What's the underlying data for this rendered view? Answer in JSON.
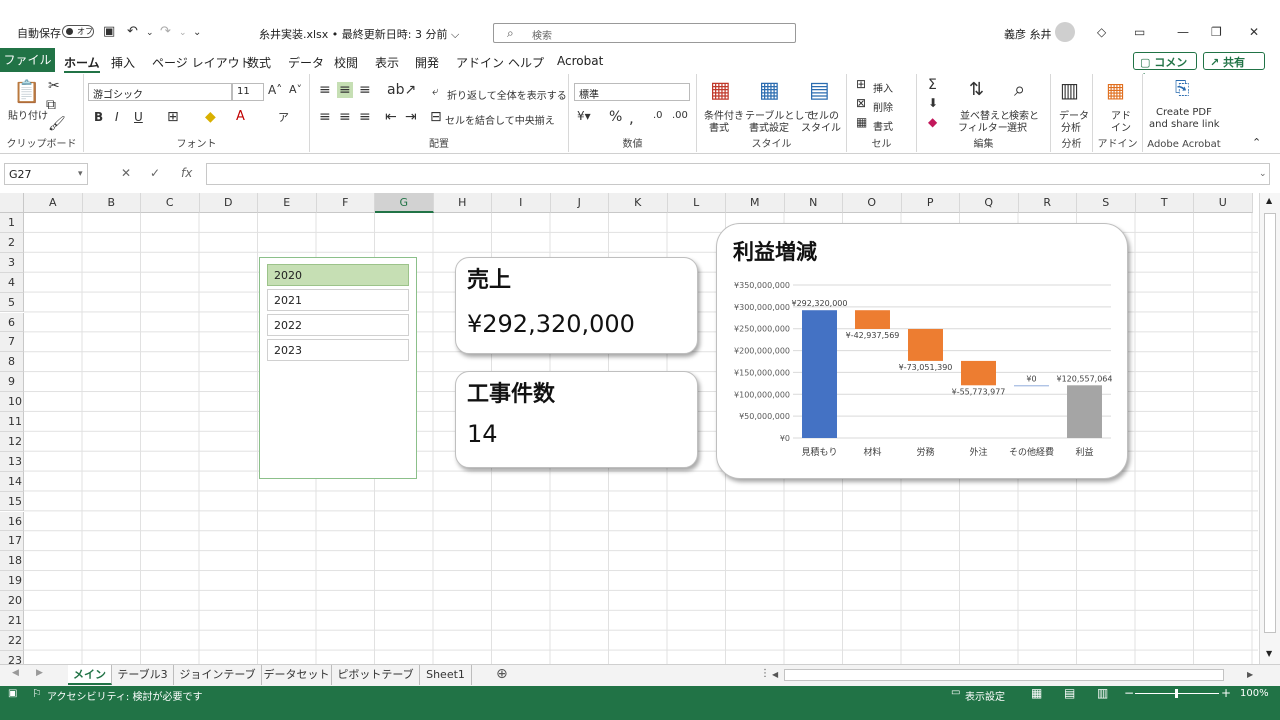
{
  "titlebar": {
    "autosave_label": "自動保存",
    "autosave_state": "オフ",
    "filename": "糸井実装.xlsx • 最終更新日時: 3 分前 ⌵",
    "search_placeholder": "検索",
    "user_name": "義彦 糸井"
  },
  "tabs": {
    "file": "ファイル",
    "home": "ホーム",
    "insert": "挿入",
    "page_layout": "ページ レイアウト",
    "formulas": "数式",
    "data": "データ",
    "review": "校閲",
    "view": "表示",
    "developer": "開発",
    "addins": "アドイン",
    "help": "ヘルプ",
    "acrobat": "Acrobat",
    "comment_btn": "コメント",
    "share_btn": "共有"
  },
  "ribbon": {
    "clipboard": {
      "label": "クリップボード",
      "paste": "貼り付け"
    },
    "font": {
      "label": "フォント",
      "font_name": "游ゴシック",
      "font_size": "11"
    },
    "alignment": {
      "label": "配置",
      "wrap": "折り返して全体を表示する",
      "merge": "セルを結合して中央揃え"
    },
    "number": {
      "label": "数値",
      "format": "標準"
    },
    "styles": {
      "label": "スタイル",
      "cond_line1": "条件付き",
      "cond_line2": "書式",
      "table_line1": "テーブルとして",
      "table_line2": "書式設定",
      "cell_line1": "セルの",
      "cell_line2": "スタイル"
    },
    "cells": {
      "label": "セル",
      "insert": "挿入",
      "delete": "削除",
      "format": "書式"
    },
    "editing": {
      "label": "編集",
      "sort_line1": "並べ替えと",
      "sort_line2": "フィルター",
      "find_line1": "検索と",
      "find_line2": "選択"
    },
    "analysis": {
      "label": "分析",
      "btn_line1": "データ",
      "btn_line2": "分析"
    },
    "addins": {
      "label": "アドイン",
      "btn_line1": "アド",
      "btn_line2": "イン"
    },
    "acrobat": {
      "label": "Adobe Acrobat",
      "btn_line1": "Create PDF",
      "btn_line2": "and share link"
    }
  },
  "formula_bar": {
    "name_box": "G27",
    "fx": "fx",
    "value": ""
  },
  "columns": [
    "A",
    "B",
    "C",
    "D",
    "E",
    "F",
    "G",
    "H",
    "I",
    "J",
    "K",
    "L",
    "M",
    "N",
    "O",
    "P",
    "Q",
    "R",
    "S",
    "T",
    "U"
  ],
  "selected_column": "G",
  "rows": [
    "1",
    "2",
    "3",
    "4",
    "5",
    "6",
    "7",
    "8",
    "9",
    "10",
    "11",
    "12",
    "13",
    "14",
    "15",
    "16",
    "17",
    "18",
    "19",
    "20",
    "21",
    "22",
    "23"
  ],
  "slicer": {
    "items": [
      "2020",
      "2021",
      "2022",
      "2023"
    ],
    "selected": "2020"
  },
  "cards": {
    "sales": {
      "title": "売上",
      "value": "¥292,320,000"
    },
    "jobs": {
      "title": "工事件数",
      "value": "14"
    }
  },
  "chart_data": {
    "type": "bar",
    "subtype": "waterfall",
    "title": "利益増減",
    "categories": [
      "見積もり",
      "材料",
      "労務",
      "外注",
      "その他経費",
      "利益"
    ],
    "values": [
      292320000,
      -42937569,
      -73051390,
      -55773977,
      0,
      120557064
    ],
    "data_labels": [
      "¥292,320,000",
      "¥-42,937,569",
      "¥-73,051,390",
      "¥-55,773,977",
      "¥0",
      "¥120,557,064"
    ],
    "ylim": [
      0,
      350000000
    ],
    "yticks": [
      0,
      50000000,
      100000000,
      150000000,
      200000000,
      250000000,
      300000000,
      350000000
    ],
    "ytick_labels": [
      "¥0",
      "¥50,000,000",
      "¥100,000,000",
      "¥150,000,000",
      "¥200,000,000",
      "¥250,000,000",
      "¥300,000,000",
      "¥350,000,000"
    ],
    "grid": true,
    "legend": "none",
    "colors": {
      "total_start": "#4472C4",
      "decrease": "#ED7D31",
      "total_end": "#A5A5A5"
    }
  },
  "sheet_tabs": [
    "メイン",
    "テーブル3",
    "ジョインテーブル",
    "データセット",
    "ピボットテーブル",
    "Sheet1"
  ],
  "active_sheet": "メイン",
  "statusbar": {
    "accessibility": "アクセシビリティ: 検討が必要です",
    "display_settings": "表示設定",
    "zoom": "100%"
  },
  "colors": {
    "excel_green": "#217346"
  }
}
